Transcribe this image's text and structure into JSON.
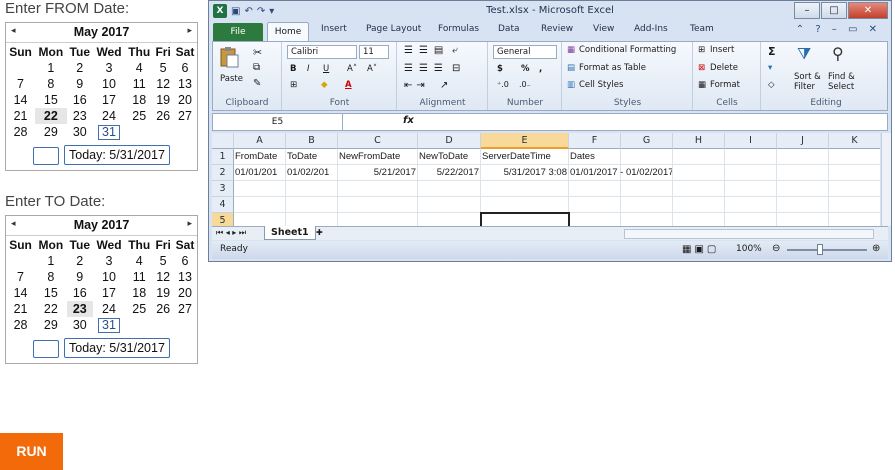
{
  "from_picker": {
    "label": "Enter FROM Date:",
    "month": "May 2017",
    "prev": "◂",
    "next": "▸",
    "weekdays": [
      "Sun",
      "Mon",
      "Tue",
      "Wed",
      "Thu",
      "Fri",
      "Sat"
    ],
    "weeks": [
      [
        "",
        "1",
        "2",
        "3",
        "4",
        "5",
        "6"
      ],
      [
        "7",
        "8",
        "9",
        "10",
        "11",
        "12",
        "13"
      ],
      [
        "14",
        "15",
        "16",
        "17",
        "18",
        "19",
        "20"
      ],
      [
        "21",
        "22",
        "23",
        "24",
        "25",
        "26",
        "27"
      ],
      [
        "28",
        "29",
        "30",
        "31",
        "",
        "",
        ""
      ]
    ],
    "selected": "22",
    "today_label": "Today: 5/31/2017"
  },
  "to_picker": {
    "label": "Enter TO Date:",
    "month": "May 2017",
    "prev": "◂",
    "next": "▸",
    "weekdays": [
      "Sun",
      "Mon",
      "Tue",
      "Wed",
      "Thu",
      "Fri",
      "Sat"
    ],
    "weeks": [
      [
        "",
        "1",
        "2",
        "3",
        "4",
        "5",
        "6"
      ],
      [
        "7",
        "8",
        "9",
        "10",
        "11",
        "12",
        "13"
      ],
      [
        "14",
        "15",
        "16",
        "17",
        "18",
        "19",
        "20"
      ],
      [
        "21",
        "22",
        "23",
        "24",
        "25",
        "26",
        "27"
      ],
      [
        "28",
        "29",
        "30",
        "31",
        "",
        "",
        ""
      ]
    ],
    "selected": "23",
    "today_label": "Today: 5/31/2017"
  },
  "today": "31",
  "run_label": "RUN",
  "excel": {
    "title": "Test.xlsx - Microsoft Excel",
    "window_buttons": {
      "minimize": "–",
      "maximize": "□",
      "close": "✕"
    },
    "tabs": [
      "File",
      "Home",
      "Insert",
      "Page Layout",
      "Formulas",
      "Data",
      "Review",
      "View",
      "Add-Ins",
      "Team"
    ],
    "ribbon": {
      "clipboard": {
        "label": "Clipboard",
        "paste": "Paste"
      },
      "font": {
        "label": "Font",
        "name": "Calibri",
        "size": "11",
        "bold": "B",
        "italic": "I",
        "underline": "U",
        "grow": "A˄",
        "shrink": "A˅"
      },
      "alignment": {
        "label": "Alignment"
      },
      "number": {
        "label": "Number",
        "format": "General",
        "currency": "$",
        "percent": "%",
        "comma": ","
      },
      "styles": {
        "label": "Styles",
        "conditional": "Conditional Formatting",
        "format_table": "Format as Table",
        "cell_styles": "Cell Styles"
      },
      "cells": {
        "label": "Cells",
        "insert": "Insert",
        "delete": "Delete",
        "format": "Format"
      },
      "editing": {
        "label": "Editing",
        "sort": "Sort &",
        "filter": "Filter",
        "find": "Find &",
        "select": "Select",
        "sigma": "Σ"
      }
    },
    "name_box": "E5",
    "fx": "fx",
    "columns": [
      "A",
      "B",
      "C",
      "D",
      "E",
      "F",
      "G",
      "H",
      "I",
      "J",
      "K"
    ],
    "rows": [
      "1",
      "2",
      "3",
      "4",
      "5"
    ],
    "cells": {
      "A1": "FromDate",
      "B1": "ToDate",
      "C1": "NewFromDate",
      "D1": "NewToDate",
      "E1": "ServerDateTime",
      "F1": "Dates",
      "A2": "01/01/201",
      "B2": "01/02/201",
      "C2": "5/21/2017",
      "D2": "5/22/2017",
      "E2": "5/31/2017 3:08",
      "F2": "01/01/2017 - 01/02/2017"
    },
    "sheet_tab": "Sheet1",
    "status": "Ready",
    "zoom": "100%"
  }
}
